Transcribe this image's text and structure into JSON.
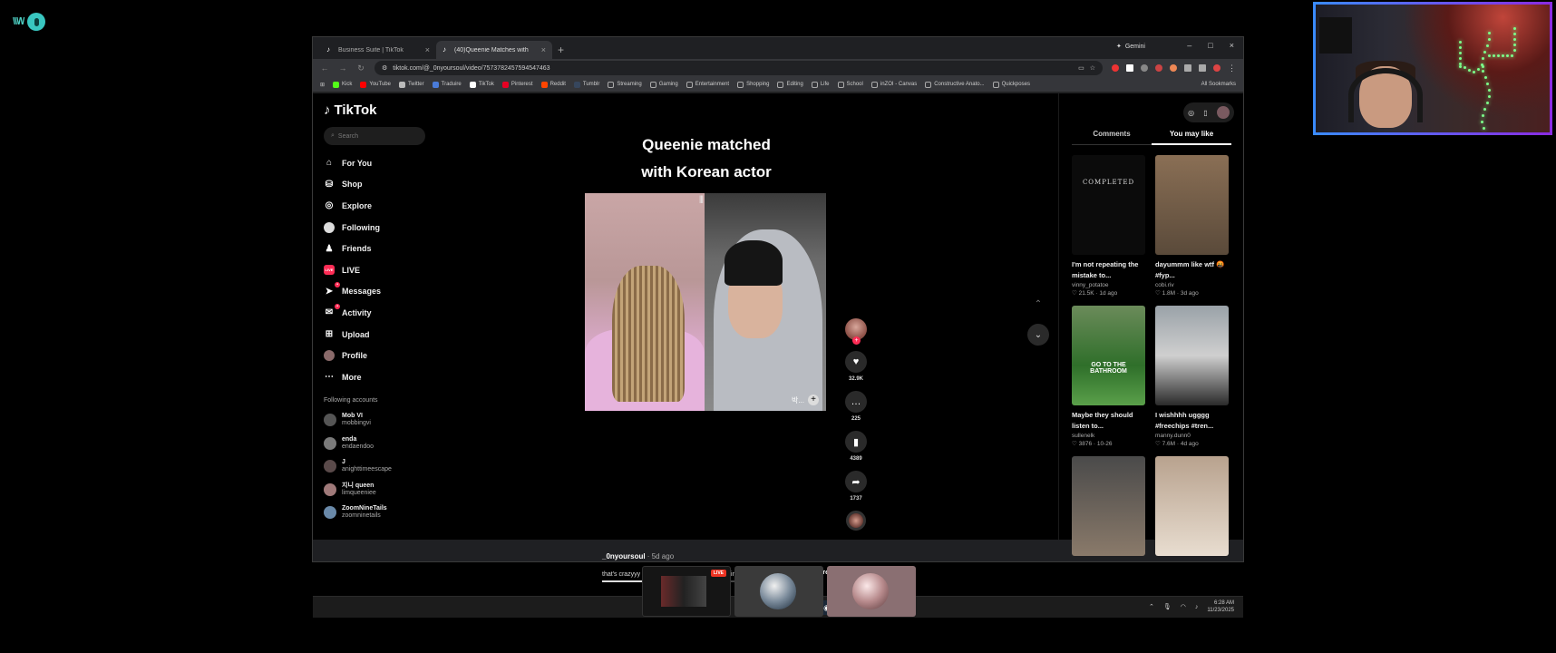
{
  "browser": {
    "tabs": [
      {
        "label": "Business Suite | TikTok",
        "active": false
      },
      {
        "label": "(40)Queenie Matches with",
        "active": true
      }
    ],
    "gemini_label": "Gemini",
    "url": "tiktok.com/@_0nyoursoul/video/7573782457594547463",
    "bookmarks": [
      "Kick",
      "YouTube",
      "Twitter",
      "Traduire",
      "TikTok",
      "Pinterest",
      "Reddit",
      "Tumblr",
      "Streaming",
      "Gaming",
      "Entertainment",
      "Shopping",
      "Editing",
      "Life",
      "School",
      "inZOI - Canvas",
      "Constructive Anato...",
      "Quickposes"
    ],
    "all_bookmarks": "All Sookmarks"
  },
  "tiktok": {
    "logo": "TikTok",
    "search_placeholder": "Search",
    "nav": [
      "For You",
      "Shop",
      "Explore",
      "Following",
      "Friends",
      "LIVE",
      "Messages",
      "Activity",
      "Upload",
      "Profile",
      "More"
    ],
    "following_title": "Following accounts",
    "following": [
      {
        "name": "Mob VI",
        "handle": "mobbingvi"
      },
      {
        "name": "enda",
        "handle": "endaendoo"
      },
      {
        "name": "J",
        "handle": "anighttimeescape"
      },
      {
        "name": "지니 queen",
        "handle": "limqueeniee"
      },
      {
        "name": "ZoomNineTails",
        "handle": "zoomninetails"
      }
    ]
  },
  "video": {
    "caption_line1": "Queenie matched",
    "caption_line2": "with Korean actor",
    "tag_text": "박...",
    "likes": "32.9K",
    "comments": "225",
    "saves": "4389",
    "shares": "1737",
    "handle": "_0nyoursoul",
    "ago": " · 5d ago",
    "description": "that's crazyyy @지니 queen @impactorpjb #blindkdrama ...",
    "more": "more",
    "progress": 0.18
  },
  "right_panel": {
    "tabs": [
      "Comments",
      "You may like"
    ],
    "active_tab": "You may like",
    "cards": [
      {
        "thumb_text": "COMPLETED",
        "title": "I'm not repeating the mistake to...",
        "user": "vinny_potatoe",
        "stats": "♡ 21.5K · 1d ago"
      },
      {
        "thumb_text": "",
        "title": "dayummm like wtf 🤬 #fyp...",
        "user": "cobi.riv",
        "stats": "♡ 1.8M · 3d ago"
      },
      {
        "thumb_text": "GO TO THE BATHROOM",
        "title": "Maybe they should listen to...",
        "user": "sullenelk",
        "stats": "♡ 3876 · 10-26"
      },
      {
        "thumb_text": "",
        "title": "I wishhhh ugggg #freechips #tren...",
        "user": "manny.dunn0",
        "stats": "♡ 7.6M · 4d ago"
      },
      {
        "thumb_text": "",
        "title": "",
        "user": "",
        "stats": ""
      },
      {
        "thumb_text": "",
        "title": "",
        "user": "",
        "stats": ""
      }
    ]
  },
  "taskbar": {
    "time": "6:28 AM",
    "date": "11/23/2025"
  },
  "stream": {
    "live_label": "LIVE"
  }
}
